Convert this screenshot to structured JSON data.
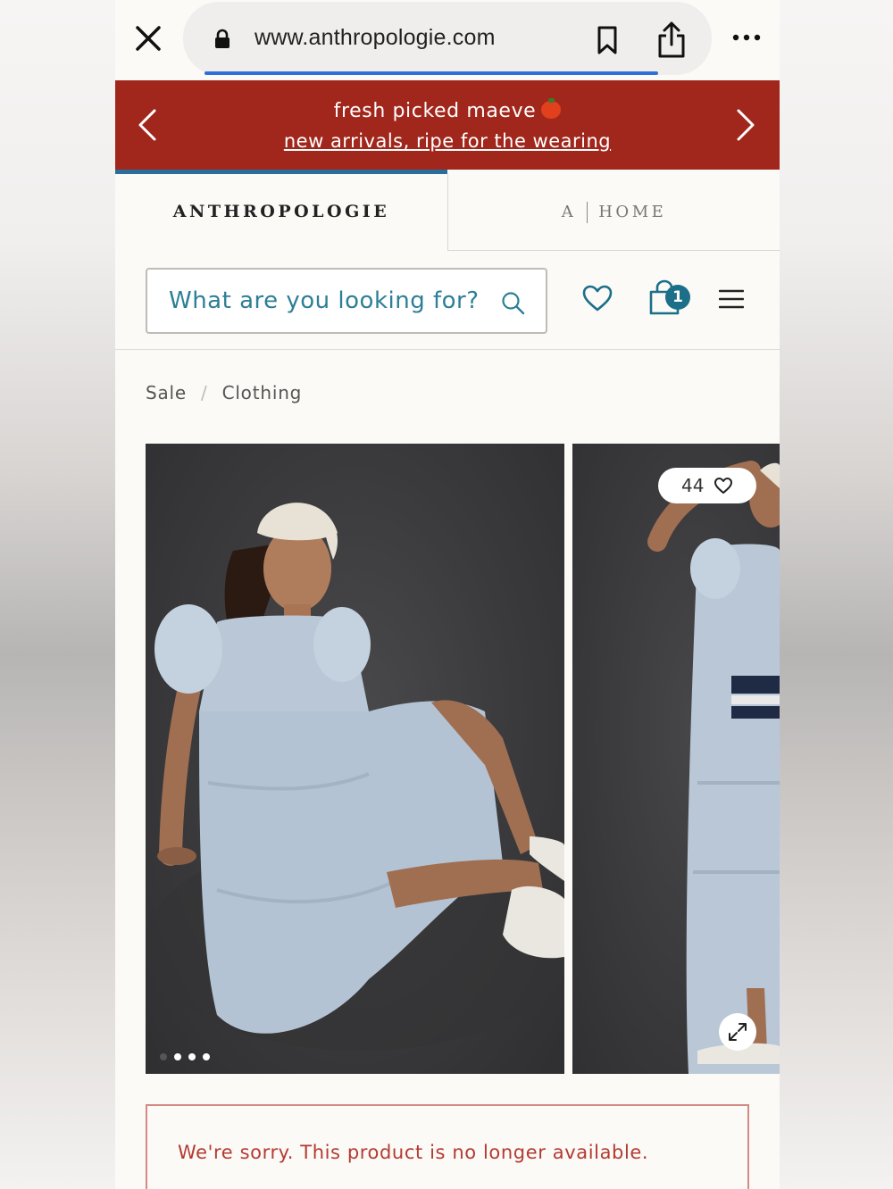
{
  "browser": {
    "url": "www.anthropologie.com"
  },
  "promo": {
    "title": "fresh picked maeve",
    "link": "new arrivals, ripe for the wearing"
  },
  "brand_tabs": {
    "anthropologie": "ANTHROPOLOGIE",
    "home_letter": "A",
    "home_label": "HOME"
  },
  "search": {
    "placeholder": "What are you looking for?"
  },
  "header": {
    "bag_count": "1"
  },
  "breadcrumb": {
    "items": [
      "Sale",
      "Clothing"
    ],
    "separator": "/"
  },
  "gallery": {
    "likes": "44",
    "dots_total": 4,
    "dots_active": 1
  },
  "notice": {
    "message": "We're sorry. This product is no longer available."
  },
  "colors": {
    "promo_bg": "#a1271c",
    "accent_teal": "#1b6f88",
    "error_text": "#b53a30"
  }
}
